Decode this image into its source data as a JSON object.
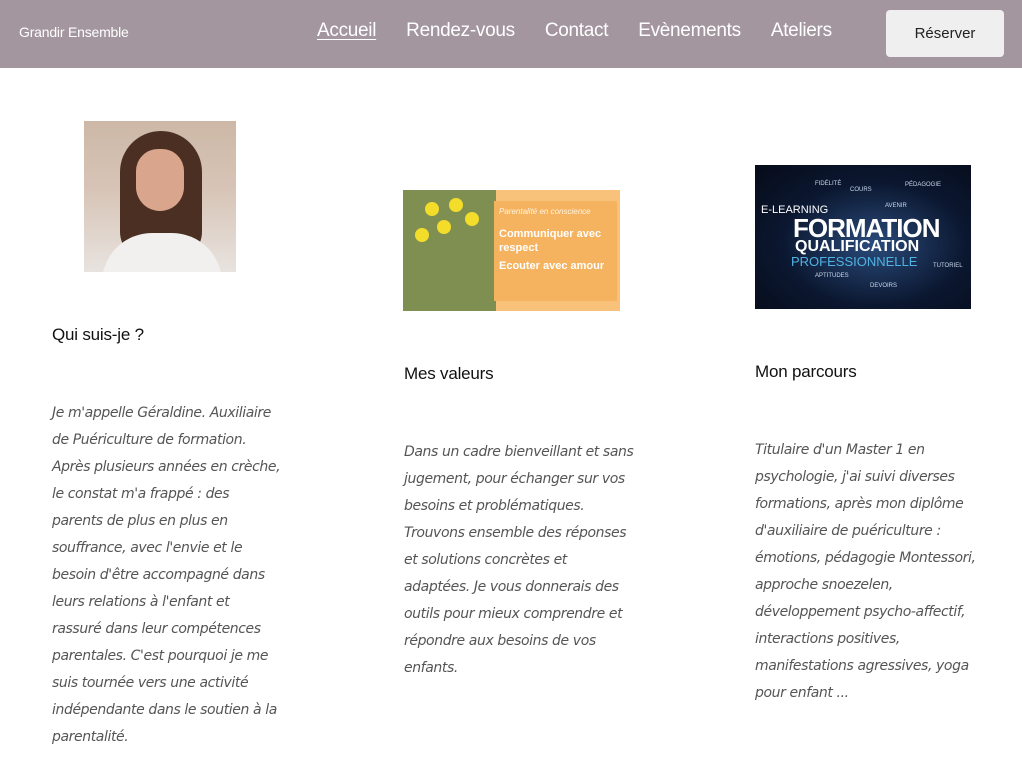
{
  "header": {
    "brand": "Grandir Ensemble",
    "nav": [
      "Accueil",
      "Rendez-vous",
      "Contact",
      "Evènements",
      "Ateliers"
    ],
    "active_nav": "Accueil",
    "cta_label": "Réserver",
    "background_color": "#a3969e"
  },
  "sections": [
    {
      "title": "Qui suis-je ?",
      "text": "Je m'appelle Géraldine. Auxiliaire de Puériculture de formation. Après plusieurs années en crèche, le constat m'a frappé : des parents de plus en plus en souffrance, avec l'envie et le besoin d'être accompagné dans leurs relations à l'enfant et rassuré dans leur compétences parentales. C'est pourquoi je me suis tournée vers une activité indépendante dans le soutien à la parentalité."
    },
    {
      "title": "Mes valeurs",
      "text": "Dans un cadre bienveillant et sans jugement, pour échanger sur vos besoins et problématiques. Trouvons ensemble des réponses et solutions concrètes et adaptées. Je vous donnerais des outils pour mieux comprendre et répondre aux besoins de vos enfants.",
      "image_text": {
        "subtitle": "Parentalité en conscience",
        "line1": "Communiquer avec",
        "line2": "respect",
        "line3": "Ecouter avec amour"
      }
    },
    {
      "title": "Mon parcours",
      "text": "Titulaire d'un Master 1 en psychologie, j'ai suivi diverses formations, après mon diplôme d'auxiliaire de puériculture : émotions, pédagogie Montessori, approche snoezelen, développement psycho-affectif, interactions positives, manifestations agressives, yoga pour enfant ...",
      "image_text": {
        "word_main": "FORMATION",
        "word_2": "QUALIFICATION",
        "word_3": "PROFESSIONNELLE",
        "word_4": "E-LEARNING"
      }
    }
  ]
}
